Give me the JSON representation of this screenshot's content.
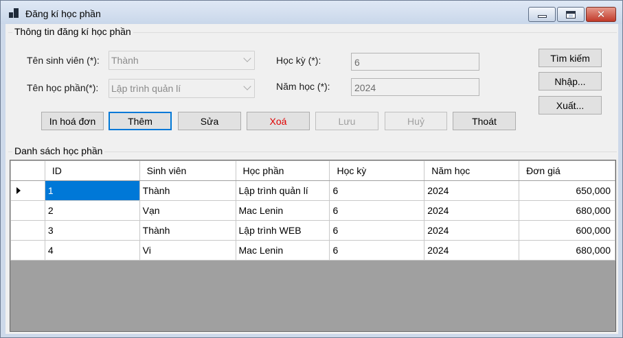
{
  "window": {
    "title": "Đăng kí học phần",
    "close_glyph": "✕"
  },
  "form": {
    "group_title": "Thông tin đăng kí học phần",
    "student_label": "Tên sinh viên (*):",
    "student_value": "Thành",
    "course_label": "Tên học phần(*):",
    "course_value": "Lập trình quản lí",
    "semester_label": "Học kỳ (*):",
    "semester_value": "6",
    "year_label": "Năm học (*):",
    "year_value": "2024"
  },
  "side_buttons": {
    "search": "Tìm kiếm",
    "import": "Nhập...",
    "export": "Xuất..."
  },
  "buttons": {
    "print": "In hoá đơn",
    "add": "Thêm",
    "edit": "Sửa",
    "delete": "Xoá",
    "save": "Lưu",
    "cancel": "Huỷ",
    "exit": "Thoát"
  },
  "list": {
    "group_title": "Danh sách học phần",
    "columns": [
      "ID",
      "Sinh viên",
      "Học phần",
      "Học kỳ",
      "Năm học",
      "Đơn giá"
    ],
    "rows": [
      [
        "1",
        "Thành",
        "Lập trình quản lí",
        "6",
        "2024",
        "650,000"
      ],
      [
        "2",
        "Vạn",
        "Mac Lenin",
        "6",
        "2024",
        "680,000"
      ],
      [
        "3",
        "Thành",
        "Lập trình WEB",
        "6",
        "2024",
        "600,000"
      ],
      [
        "4",
        "Vi",
        "Mac Lenin",
        "6",
        "2024",
        "680,000"
      ]
    ],
    "selected_row": 0
  },
  "colors": {
    "selection": "#0078d7",
    "delete_text": "#e00000",
    "grid_empty_area": "#a0a0a0"
  }
}
